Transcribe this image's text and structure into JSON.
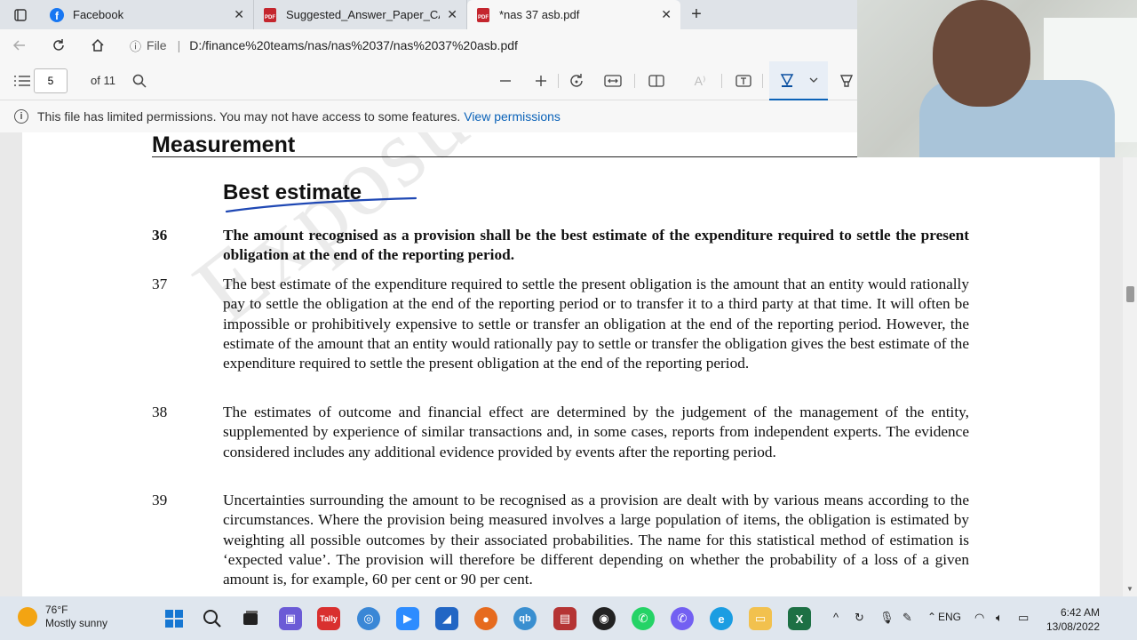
{
  "browser": {
    "tabs": [
      {
        "title": "Facebook",
        "icon": "facebook-icon",
        "active": false
      },
      {
        "title": "Suggested_Answer_Paper_CAP_II",
        "icon": "pdf-icon",
        "active": false
      },
      {
        "title": "*nas 37 asb.pdf",
        "icon": "pdf-icon",
        "active": true
      }
    ],
    "close_glyph": "✕",
    "new_tab_glyph": "+",
    "url_prefix": "File",
    "url": "D:/finance%20teams/nas/nas%2037/nas%2037%20asb.pdf"
  },
  "pdf_toolbar": {
    "current_page": "5",
    "total_pages": "of 11"
  },
  "permission_bar": {
    "message": "This file has limited permissions. You may not have access to some features.",
    "link": "View permissions"
  },
  "document": {
    "section_heading": "Measurement",
    "subheading": "Best estimate",
    "paragraphs": [
      {
        "num": "36",
        "bold": true,
        "text": "The amount recognised as a provision shall be the best estimate of the expenditure required to settle the present obligation at the end of the reporting period."
      },
      {
        "num": "37",
        "bold": false,
        "text": "The best estimate of the expenditure required to settle the present obligation is the amount that an entity would rationally pay to settle the obligation at the end of the reporting period or to transfer it to a third party at that time. It will often be impossible or prohibitively expensive to settle or transfer an obligation at the end of the reporting period. However, the estimate of the amount that an entity would rationally pay to settle or transfer the obligation gives the best estimate of the expenditure required to settle the present obligation at the end of the reporting period."
      },
      {
        "num": "38",
        "bold": false,
        "text": "The estimates of outcome and financial effect are determined by the judgement of the management of the entity, supplemented by experience of similar transactions and, in some cases, reports from independent experts. The evidence considered includes any additional evidence provided by events after the reporting period."
      },
      {
        "num": "39",
        "bold": false,
        "text": "Uncertainties surrounding the amount to be recognised as a provision are dealt with by various means according to the circumstances. Where the provision being measured involves a large population of items, the obligation is estimated by weighting all possible outcomes by their associated probabilities. The name for this statistical method of estimation is ‘expected value’. The provision will therefore be different depending on whether the probability of a loss of a given amount is, for example, 60 per cent or 90 per cent."
      }
    ]
  },
  "taskbar": {
    "temperature": "76°F",
    "condition": "Mostly sunny",
    "language": "ENG",
    "time": "6:42 AM",
    "date": "13/08/2022"
  }
}
